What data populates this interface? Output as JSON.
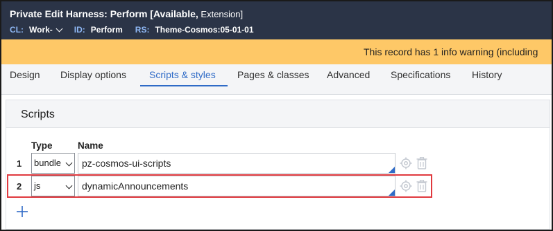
{
  "header": {
    "title": "Private Edit  Harness: Perform [Available,",
    "title_ext": " Extension]",
    "cl_key": "CL:",
    "cl_val": "Work-",
    "id_key": "ID:",
    "id_val": "Perform",
    "rs_key": "RS:",
    "rs_val": "Theme-Cosmos:05-01-01"
  },
  "warning": {
    "text": "This record has 1 info warning (including"
  },
  "tabs": [
    {
      "label": "Design"
    },
    {
      "label": "Display options"
    },
    {
      "label": "Scripts & styles",
      "active": true
    },
    {
      "label": "Pages & classes"
    },
    {
      "label": "Advanced"
    },
    {
      "label": "Specifications"
    },
    {
      "label": "History"
    }
  ],
  "scripts": {
    "section_title": "Scripts",
    "col_type": "Type",
    "col_name": "Name",
    "rows": [
      {
        "num": "1",
        "type": "bundle",
        "name": "pz-cosmos-ui-scripts"
      },
      {
        "num": "2",
        "type": "js",
        "name": "dynamicAnnouncements"
      }
    ]
  },
  "colors": {
    "header_bg": "#2b3447",
    "warning_bg": "#fec867",
    "accent": "#2f6bc7",
    "highlight": "#e0393e"
  },
  "icons": {
    "dropdown": "chevron-down-icon",
    "settings": "gear-icon",
    "delete": "trash-icon",
    "add": "plus-icon"
  }
}
